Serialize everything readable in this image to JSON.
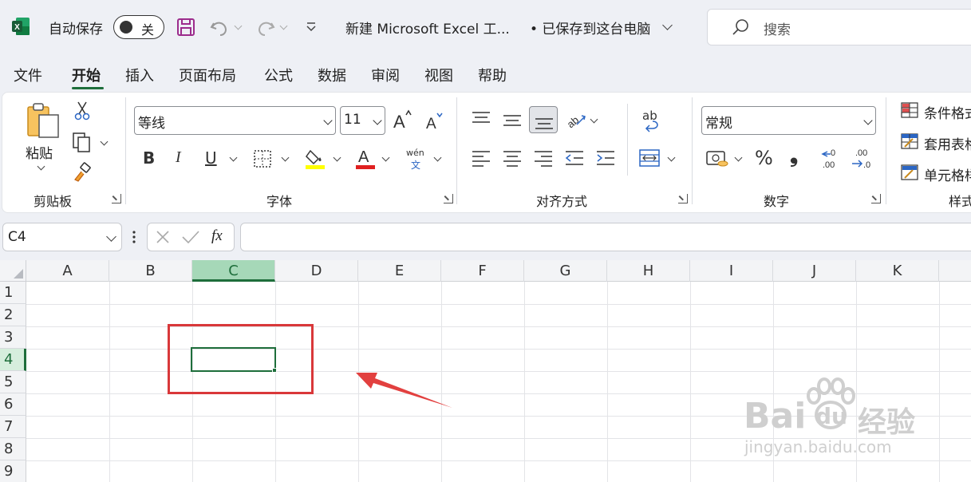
{
  "titlebar": {
    "app_icon": "excel-logo-icon",
    "autosave_label": "自动保存",
    "autosave_state": "关",
    "save_icon": "save-icon",
    "undo_icon": "undo-icon",
    "redo_icon": "redo-icon",
    "customize_icon": "customize-toolbar-icon",
    "doc_title": "新建 Microsoft Excel 工...",
    "save_status": "• 已保存到这台电脑",
    "search_placeholder": "搜索"
  },
  "menu_tabs": [
    "文件",
    "开始",
    "插入",
    "页面布局",
    "公式",
    "数据",
    "审阅",
    "视图",
    "帮助"
  ],
  "active_tab": "开始",
  "ribbon": {
    "clipboard": {
      "paste_label": "粘贴",
      "group_label": "剪贴板"
    },
    "font": {
      "font_name": "等线",
      "font_size": "11",
      "grow_font": "A^",
      "shrink_font": "Aˇ",
      "bold": "B",
      "italic": "I",
      "underline": "U",
      "pinyin": "wén",
      "pinyin_char": "文",
      "group_label": "字体",
      "highlight_color": "#ffff00",
      "font_color": "#e02020"
    },
    "alignment": {
      "wrap_label": "ab",
      "group_label": "对齐方式"
    },
    "number": {
      "format": "常规",
      "percent": "%",
      "comma": "❟",
      "inc_decimal": ".00",
      "dec_decimal": ".0",
      "group_label": "数字"
    },
    "styles": {
      "conditional": "条件格式",
      "table": "套用表格",
      "cell": "单元格样",
      "group_label": "样式"
    }
  },
  "formula_bar": {
    "name_box": "C4",
    "fx": "fx",
    "content": ""
  },
  "sheet": {
    "columns": [
      "A",
      "B",
      "C",
      "D",
      "E",
      "F",
      "G",
      "H",
      "I",
      "J",
      "K"
    ],
    "rows": [
      "1",
      "2",
      "3",
      "4",
      "5",
      "6",
      "7",
      "8",
      "9"
    ],
    "selected_col": "C",
    "selected_row": "4"
  },
  "watermark": {
    "line1": "Bai",
    "line1b": "du",
    "line1c": "经验",
    "line2": "jingyan.baidu.com"
  },
  "colors": {
    "accent": "#1e6e3b",
    "annotation": "#d9383a"
  }
}
